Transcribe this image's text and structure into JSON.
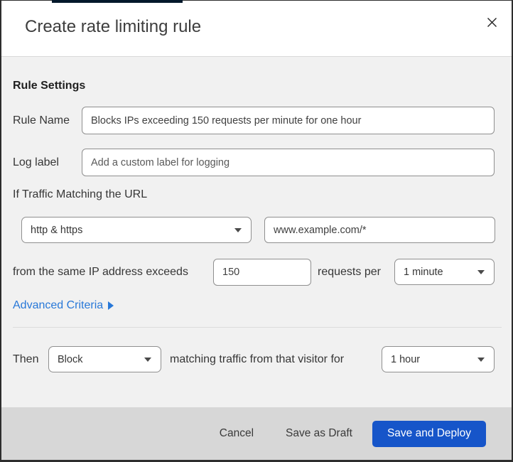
{
  "modal": {
    "title": "Create rate limiting rule"
  },
  "form": {
    "section_heading": "Rule Settings",
    "rule_name": {
      "label": "Rule Name",
      "value": "Blocks IPs exceeding 150 requests per minute for one hour"
    },
    "log_label": {
      "label": "Log label",
      "placeholder": "Add a custom label for logging"
    },
    "traffic": {
      "intro": "If Traffic Matching the URL",
      "scheme": "http & https",
      "url": "www.example.com/*",
      "exceeds_text": "from the same IP address exceeds",
      "threshold": "150",
      "per_text": "requests per",
      "period": "1 minute"
    },
    "advanced_criteria_label": "Advanced Criteria",
    "then": {
      "label": "Then",
      "action": "Block",
      "middle_text": "matching traffic from that visitor for",
      "duration": "1 hour"
    }
  },
  "footer": {
    "cancel_label": "Cancel",
    "save_draft_label": "Save as Draft",
    "save_deploy_label": "Save and Deploy"
  },
  "colors": {
    "primary_button": "#1655c9",
    "link": "#2878d8",
    "body_bg": "#f1f1f1",
    "footer_bg": "#d7d7d7",
    "top_strip": "#03182b"
  }
}
